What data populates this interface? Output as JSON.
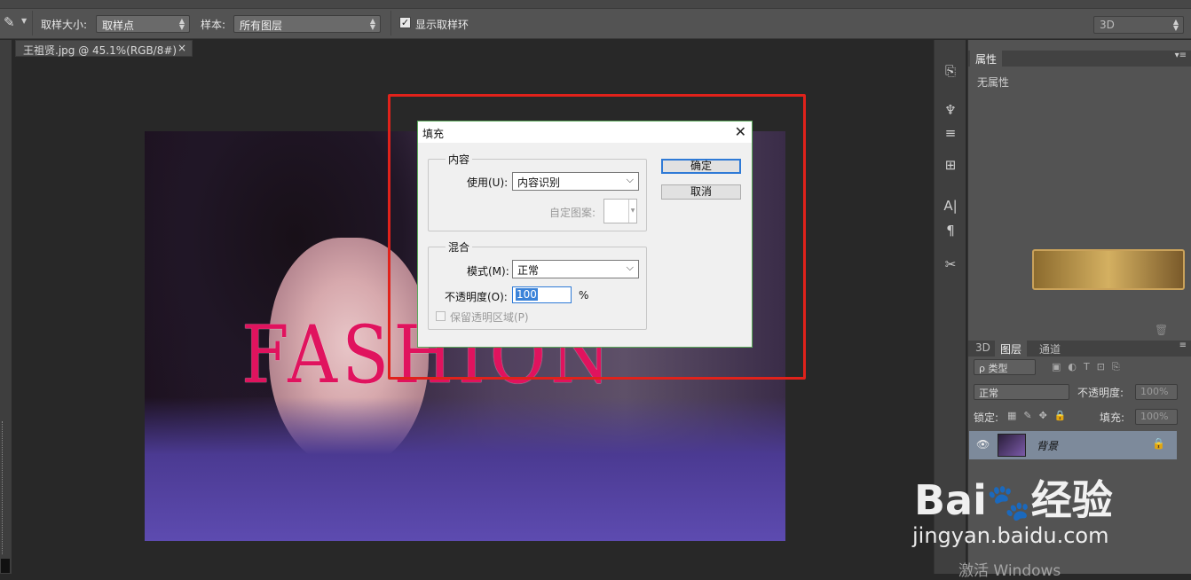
{
  "options_bar": {
    "sample_size_label": "取样大小:",
    "sample_size_value": "取样点",
    "sample_label": "样本:",
    "sample_value": "所有图层",
    "show_ring_label": "显示取样环",
    "workspace_value": "3D"
  },
  "document": {
    "tab_title": "王祖贤.jpg @ 45.1%(RGB/8#) *",
    "tab_close": "×",
    "canvas_text": "FASHION"
  },
  "fill_dialog": {
    "title": "填充",
    "close": "✕",
    "content_group": "内容",
    "use_label": "使用(U):",
    "use_value": "内容识别",
    "custom_pattern_label": "自定图案:",
    "blend_group": "混合",
    "mode_label": "模式(M):",
    "mode_value": "正常",
    "opacity_label": "不透明度(O):",
    "opacity_value": "100",
    "opacity_unit": "%",
    "preserve_label": "保留透明区域(P)",
    "ok_button": "确定",
    "cancel_button": "取消"
  },
  "properties_panel": {
    "tab": "属性",
    "empty_text": "无属性"
  },
  "layers_panel": {
    "tabs": [
      "3D",
      "图层",
      "通道"
    ],
    "filter_label": "ρ 类型",
    "blend_mode": "正常",
    "opacity_label": "不透明度:",
    "opacity_value": "100%",
    "lock_label": "锁定:",
    "fill_label": "填充:",
    "fill_value": "100%",
    "layer_name": "背景"
  },
  "watermark": {
    "brand": "Bai",
    "brand_cn": "经验",
    "url": "jingyan.baidu.com"
  },
  "windows_activation": "激活 Windows"
}
